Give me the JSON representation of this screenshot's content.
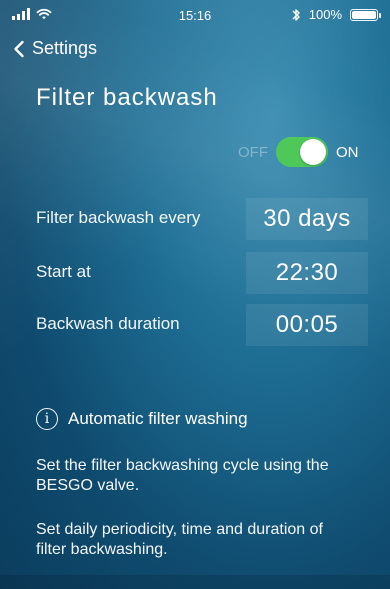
{
  "status_bar": {
    "time": "15:16",
    "battery_text": "100%",
    "icons": [
      "signal-icon",
      "wifi-icon",
      "bluetooth-icon",
      "battery-icon"
    ]
  },
  "nav": {
    "back_label": "Settings"
  },
  "page": {
    "title": "Filter backwash",
    "toggle": {
      "off_label": "OFF",
      "on_label": "ON",
      "state": "on",
      "color": "#4fc85a"
    }
  },
  "settings": {
    "every_label": "Filter backwash every",
    "every_value": "30 days",
    "start_label": "Start at",
    "start_value": "22:30",
    "duration_label": "Backwash duration",
    "duration_value": "00:05"
  },
  "info": {
    "heading": "Automatic filter washing",
    "text1": "Set the filter backwashing cycle using the BESGO valve.",
    "text2": "Set daily periodicity, time and duration of filter backwashing."
  }
}
